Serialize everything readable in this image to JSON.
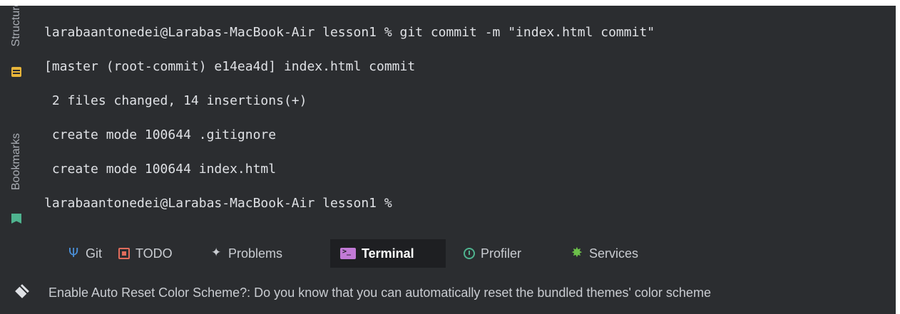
{
  "left_stripe": {
    "structure_label": "Structure",
    "structure_icon": "structure-icon",
    "bookmarks_label": "Bookmarks",
    "bookmarks_icon": "bookmark-icon"
  },
  "terminal": {
    "lines": [
      "larabaantonedei@Larabas-MacBook-Air lesson1 % git commit -m \"index.html commit\"",
      "[master (root-commit) e14ea4d] index.html commit",
      " 2 files changed, 14 insertions(+)",
      " create mode 100644 .gitignore",
      " create mode 100644 index.html",
      "larabaantonedei@Larabas-MacBook-Air lesson1 %"
    ]
  },
  "tool_tabs": [
    {
      "label": "Git",
      "icon": "git-branch-icon"
    },
    {
      "label": "TODO",
      "icon": "todo-icon"
    },
    {
      "label": "Problems",
      "icon": "problems-icon"
    },
    {
      "label": "Terminal",
      "icon": "terminal-icon",
      "active": true
    },
    {
      "label": "Profiler",
      "icon": "profiler-icon"
    },
    {
      "label": "Services",
      "icon": "services-icon"
    }
  ],
  "status": {
    "icon": "layers-icon",
    "text": "Enable Auto Reset Color Scheme?: Do you know that you can automatically reset the bundled themes' color scheme"
  },
  "colors": {
    "background": "#2b2d30",
    "active_tab": "#1e1f22",
    "text": "#dfe1e5"
  }
}
